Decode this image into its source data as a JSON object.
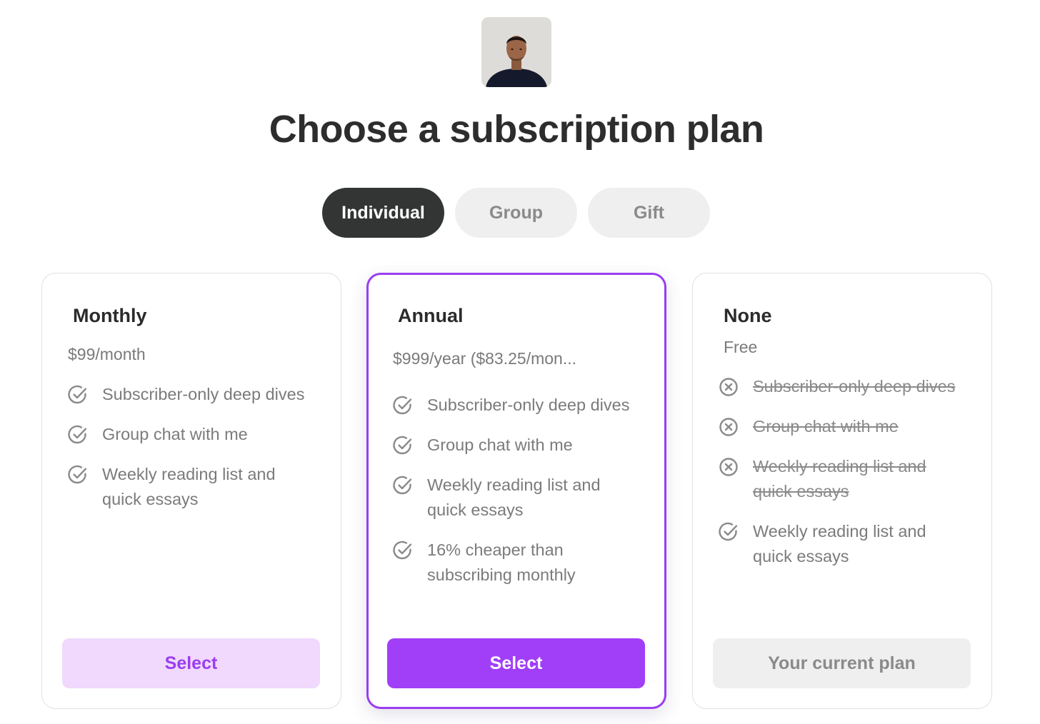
{
  "page": {
    "title": "Choose a subscription plan"
  },
  "tabs": [
    {
      "label": "Individual",
      "active": true
    },
    {
      "label": "Group",
      "active": false
    },
    {
      "label": "Gift",
      "active": false
    }
  ],
  "plans": [
    {
      "name": "Monthly",
      "price": "$99/month",
      "features": [
        {
          "text": "Subscriber-only deep dives",
          "icon": "check-circle-icon"
        },
        {
          "text": "Group chat with me",
          "icon": "check-circle-icon"
        },
        {
          "text": "Weekly reading list and quick essays",
          "icon": "check-circle-icon"
        }
      ],
      "button": "Select"
    },
    {
      "name": "Annual",
      "price": "$999/year ($83.25/mon...",
      "features": [
        {
          "text": "Subscriber-only deep dives",
          "icon": "check-circle-icon"
        },
        {
          "text": "Group chat with me",
          "icon": "check-circle-icon"
        },
        {
          "text": "Weekly reading list and quick essays",
          "icon": "check-circle-icon"
        },
        {
          "text": "16% cheaper than subscribing monthly",
          "icon": "check-circle-icon"
        }
      ],
      "button": "Select"
    },
    {
      "name": "None",
      "price": "Free",
      "features": [
        {
          "text": "Subscriber-only deep dives",
          "icon": "x-circle-icon"
        },
        {
          "text": "Group chat with me",
          "icon": "x-circle-icon"
        },
        {
          "text": "Weekly reading list and quick essays",
          "icon": "x-circle-icon"
        },
        {
          "text": "Weekly reading list and quick essays",
          "icon": "check-circle-icon"
        }
      ],
      "button": "Your current plan"
    }
  ],
  "colors": {
    "accent": "#a13ef7",
    "accent_light": "#f0d9fc",
    "featured_border": "#9b3df2",
    "active_tab": "#333535",
    "inactive": "#efefef",
    "muted_text": "#7b7b7b"
  }
}
